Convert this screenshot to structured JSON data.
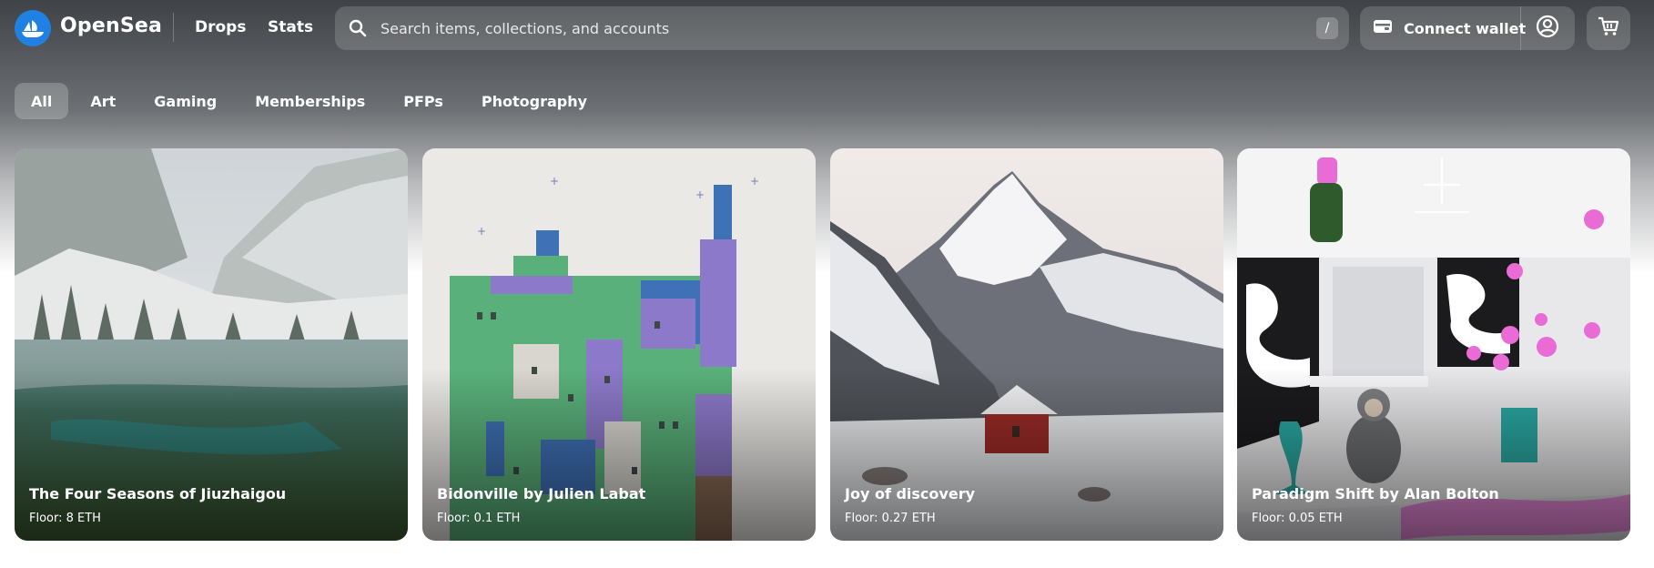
{
  "header": {
    "brand": "OpenSea",
    "nav": {
      "drops": "Drops",
      "stats": "Stats"
    },
    "search": {
      "placeholder": "Search items, collections, and accounts",
      "shortcut": "/"
    },
    "wallet": {
      "label": "Connect wallet"
    },
    "icons": [
      "opensea-logo-icon",
      "search-icon",
      "wallet-icon",
      "profile-icon",
      "cart-icon"
    ]
  },
  "categories": [
    {
      "label": "All",
      "active": true
    },
    {
      "label": "Art",
      "active": false
    },
    {
      "label": "Gaming",
      "active": false
    },
    {
      "label": "Memberships",
      "active": false
    },
    {
      "label": "PFPs",
      "active": false
    },
    {
      "label": "Photography",
      "active": false
    }
  ],
  "cards": [
    {
      "title": "The Four Seasons of Jiuzhaigou",
      "floor": "Floor: 8 ETH"
    },
    {
      "title": "Bidonville by Julien Labat",
      "floor": "Floor: 0.1 ETH"
    },
    {
      "title": "Joy of discovery",
      "floor": "Floor: 0.27 ETH"
    },
    {
      "title": "Paradigm Shift by Alan Bolton",
      "floor": "Floor: 0.05 ETH"
    }
  ],
  "colors": {
    "accent": "#2081e2",
    "pink": "#e86bd6",
    "teal": "#2aa7a1"
  }
}
